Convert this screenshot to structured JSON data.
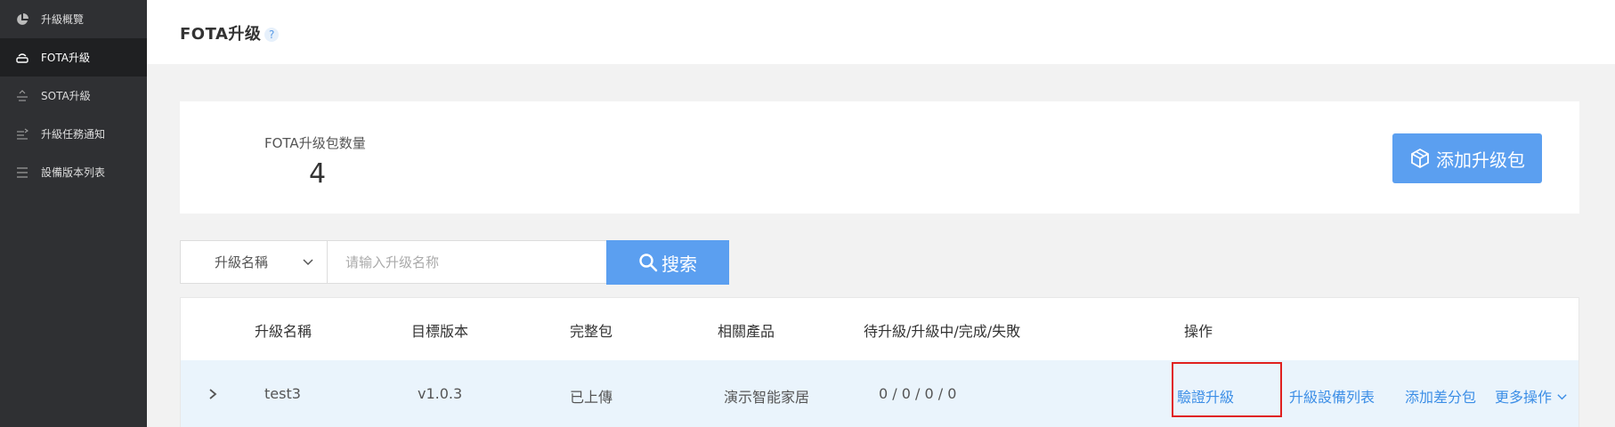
{
  "sidebar": {
    "items": [
      {
        "label": "升級概覽",
        "icon": "pie-chart-icon"
      },
      {
        "label": "FOTA升級",
        "icon": "router-icon"
      },
      {
        "label": "SOTA升級",
        "icon": "upload-icon"
      },
      {
        "label": "升級任務通知",
        "icon": "notification-list-icon"
      },
      {
        "label": "設備版本列表",
        "icon": "list-icon"
      }
    ]
  },
  "header": {
    "title": "FOTA升级",
    "help": "?"
  },
  "stats": {
    "label": "FOTA升级包数量",
    "value": "4",
    "add_button": "添加升级包"
  },
  "search": {
    "field_select": "升級名稱",
    "placeholder": "请输入升级名称",
    "button": "搜索"
  },
  "table": {
    "headers": [
      "升級名稱",
      "目標版本",
      "完整包",
      "相關產品",
      "待升級/升級中/完成/失敗",
      "操作"
    ],
    "rows": [
      {
        "name": "test3",
        "version": "v1.0.3",
        "package": "已上傳",
        "product": "演示智能家居",
        "status": "0 / 0 / 0 / 0",
        "actions": [
          "驗證升級",
          "升級設備列表",
          "添加差分包",
          "更多操作"
        ]
      }
    ]
  },
  "colors": {
    "sidebar_bg": "#2f3033",
    "accent": "#5b9ff0",
    "link": "#3c8ee6",
    "highlight": "#e0201f"
  }
}
